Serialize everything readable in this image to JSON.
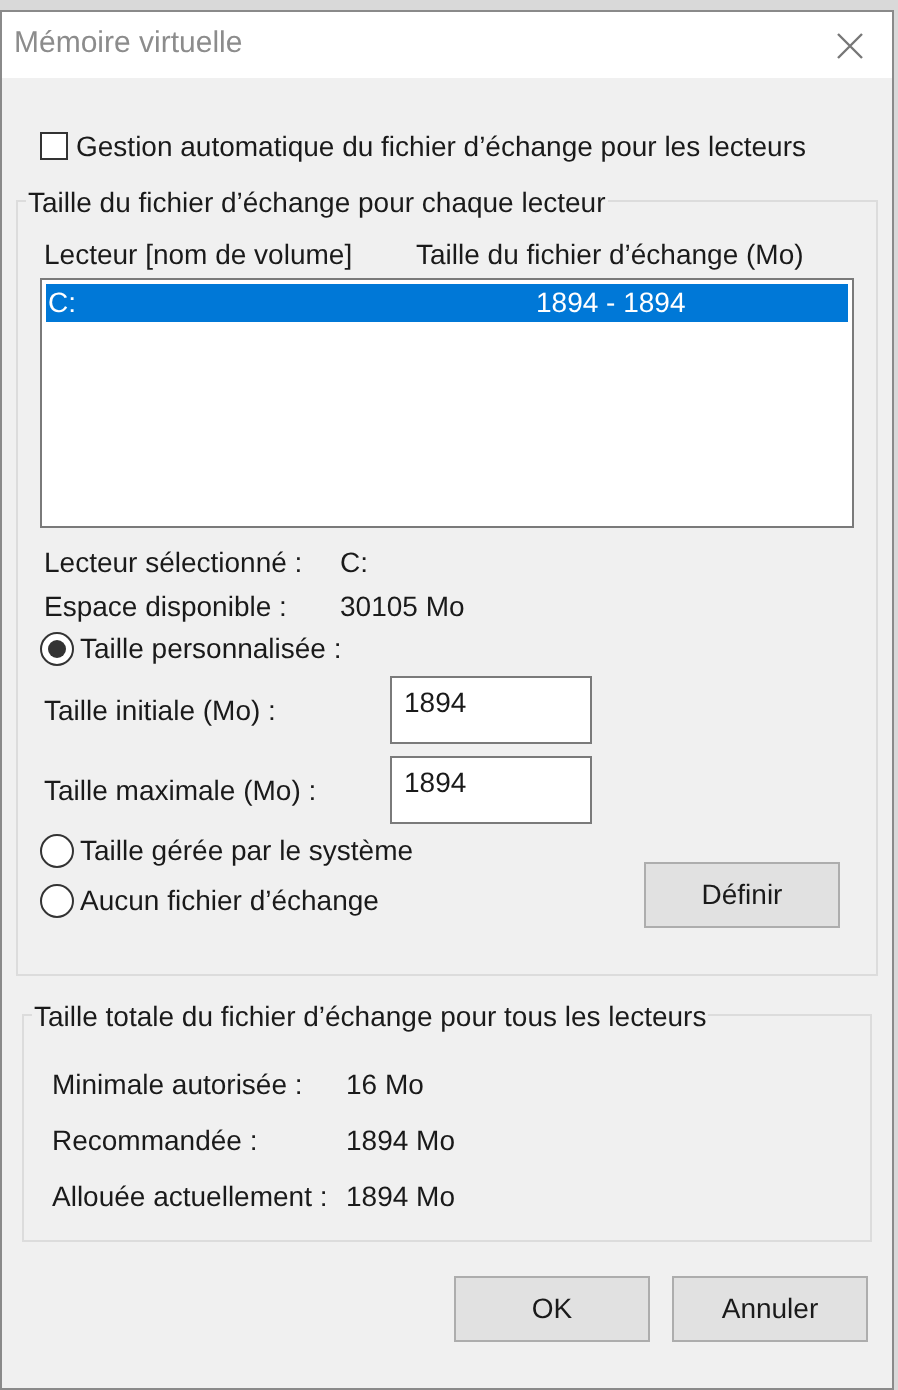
{
  "window": {
    "title": "Mémoire virtuelle"
  },
  "auto_manage": {
    "label": "Gestion automatique du fichier d’échange pour les lecteurs",
    "checked": false
  },
  "per_drive": {
    "title": "Taille du fichier d’échange pour chaque lecteur",
    "columns": [
      "Lecteur [nom de volume]",
      "Taille du fichier d’échange (Mo)"
    ],
    "rows": [
      {
        "drive": "C:",
        "size": "1894 - 1894",
        "selected": true
      }
    ],
    "info": [
      {
        "label": "Lecteur sélectionné :",
        "value": "C:"
      },
      {
        "label": "Espace disponible :",
        "value": "30105 Mo"
      }
    ],
    "options": [
      {
        "kind": "radio",
        "label": "Taille personnalisée :",
        "selected": true
      },
      {
        "kind": "field",
        "label": "Taille initiale (Mo) :",
        "value": "1894"
      },
      {
        "kind": "field",
        "label": "Taille maximale (Mo) :",
        "value": "1894"
      },
      {
        "kind": "radio",
        "label": "Taille gérée par le système",
        "selected": false
      },
      {
        "kind": "radio",
        "label": "Aucun fichier d’échange",
        "selected": false
      }
    ],
    "set_button": "Définir"
  },
  "total": {
    "title": "Taille totale du fichier d’échange pour tous les lecteurs",
    "rows": [
      {
        "label": "Minimale autorisée :",
        "value": "16 Mo"
      },
      {
        "label": "Recommandée :",
        "value": "1894 Mo"
      },
      {
        "label": "Allouée actuellement :",
        "value": "1894 Mo"
      }
    ]
  },
  "buttons": [
    "OK",
    "Annuler"
  ]
}
